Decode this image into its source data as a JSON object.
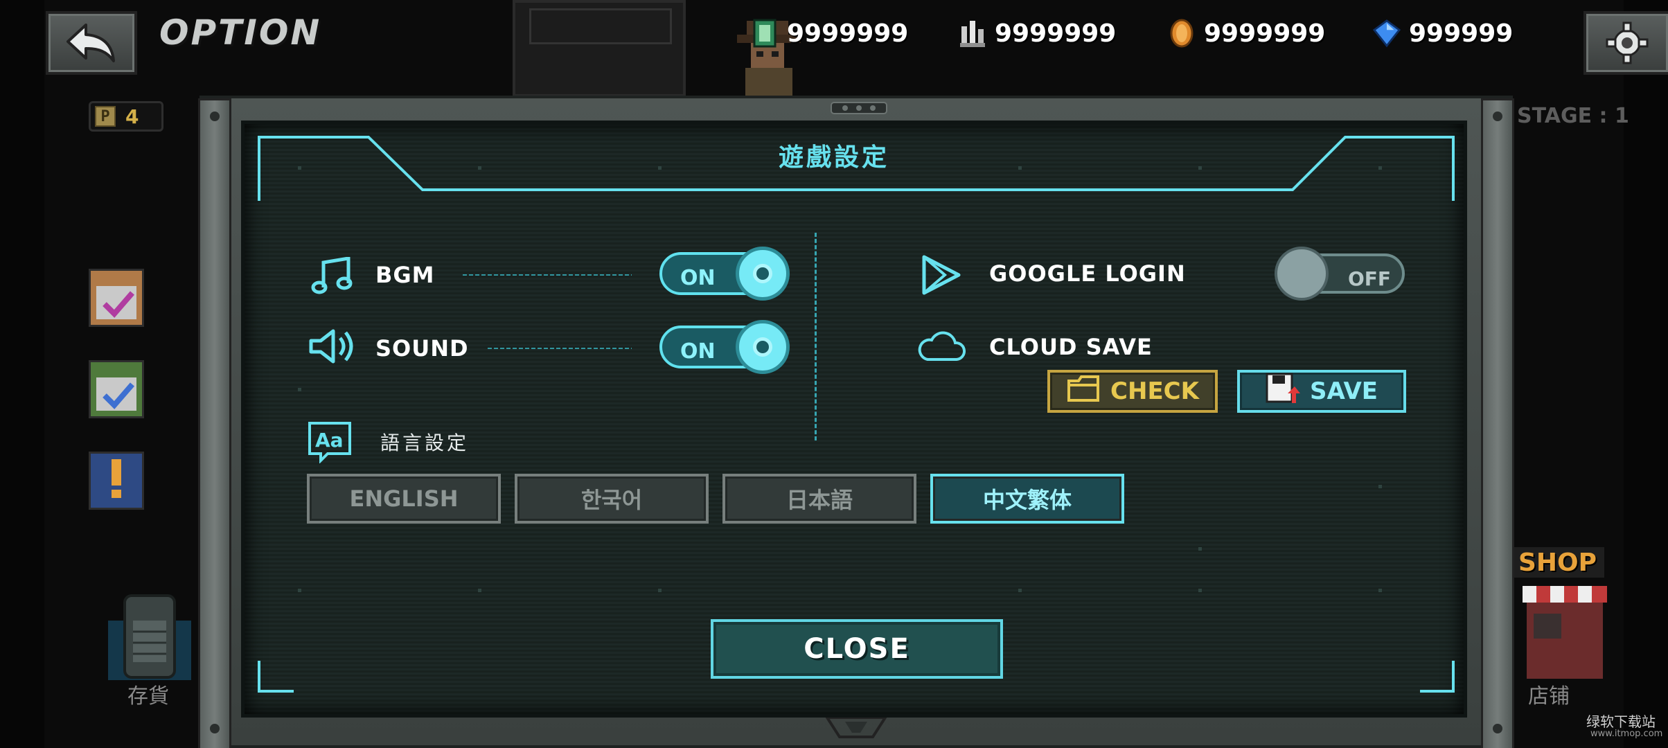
{
  "header": {
    "title": "OPTION",
    "currencies": [
      {
        "icon": "cash-icon",
        "value": "9999999"
      },
      {
        "icon": "parts-icon",
        "value": "9999999"
      },
      {
        "icon": "coin-icon",
        "value": "9999999"
      },
      {
        "icon": "gem-icon",
        "value": "999999"
      }
    ]
  },
  "side": {
    "points_value": "4",
    "stage_text": "STAGE : 1",
    "inventory_label": "存貨",
    "shop_sign": "SHOP",
    "shop_label": "店铺"
  },
  "dialog": {
    "title": "遊戲設定",
    "bgm": {
      "label": "BGM",
      "state": "ON"
    },
    "sound": {
      "label": "SOUND",
      "state": "ON"
    },
    "google_login": {
      "label": "GOOGLE LOGIN",
      "state": "OFF"
    },
    "cloud_save": {
      "label": "CLOUD SAVE",
      "check_label": "CHECK",
      "save_label": "SAVE"
    },
    "language": {
      "title": "語言設定",
      "options": [
        {
          "label": "ENGLISH",
          "selected": false
        },
        {
          "label": "한국어",
          "selected": false
        },
        {
          "label": "日本語",
          "selected": false
        },
        {
          "label": "中文繁体",
          "selected": true
        }
      ]
    },
    "close_label": "CLOSE"
  },
  "watermark": {
    "text": "绿软下载站",
    "sub": "www.itmop.com"
  },
  "colors": {
    "accent": "#67e1ee",
    "check": "#c6a541",
    "screen_bg": "#1d2826",
    "frame": "#4f5654"
  }
}
